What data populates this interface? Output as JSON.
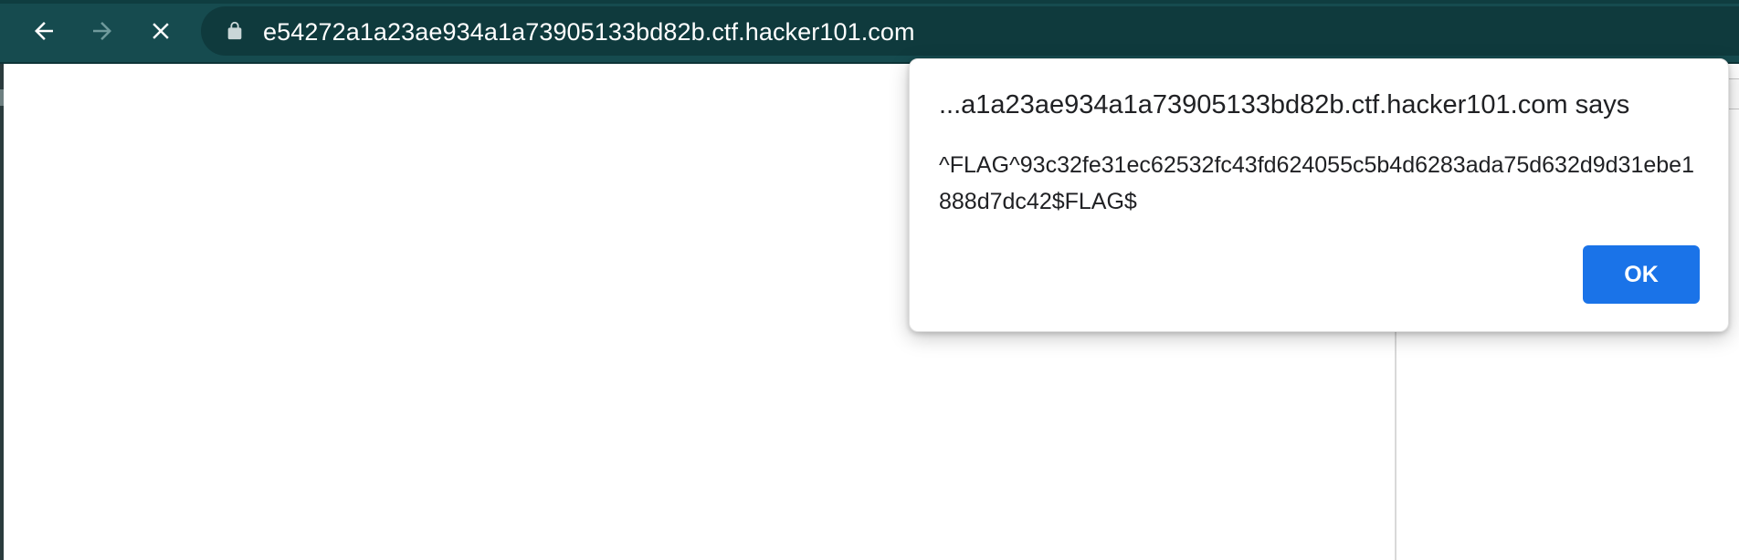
{
  "browser": {
    "url": "e54272a1a23ae934a1a73905133bd82b.ctf.hacker101.com",
    "icons": {
      "back": "arrow-left-icon",
      "forward": "arrow-right-icon",
      "stop": "close-icon",
      "lock": "lock-icon"
    },
    "colors": {
      "toolbar": "#164b4f",
      "omnibox": "#0f3a3d",
      "forward_disabled": "#6f9a9c"
    }
  },
  "alert_dialog": {
    "title": "...a1a23ae934a1a73905133bd82b.ctf.hacker101.com says",
    "message": "^FLAG^93c32fe31ec62532fc43fd624055c5b4d6283ada75d632d9d31ebe1888d7dc42$FLAG$",
    "ok_label": "OK",
    "accent_color": "#1a73e8"
  }
}
